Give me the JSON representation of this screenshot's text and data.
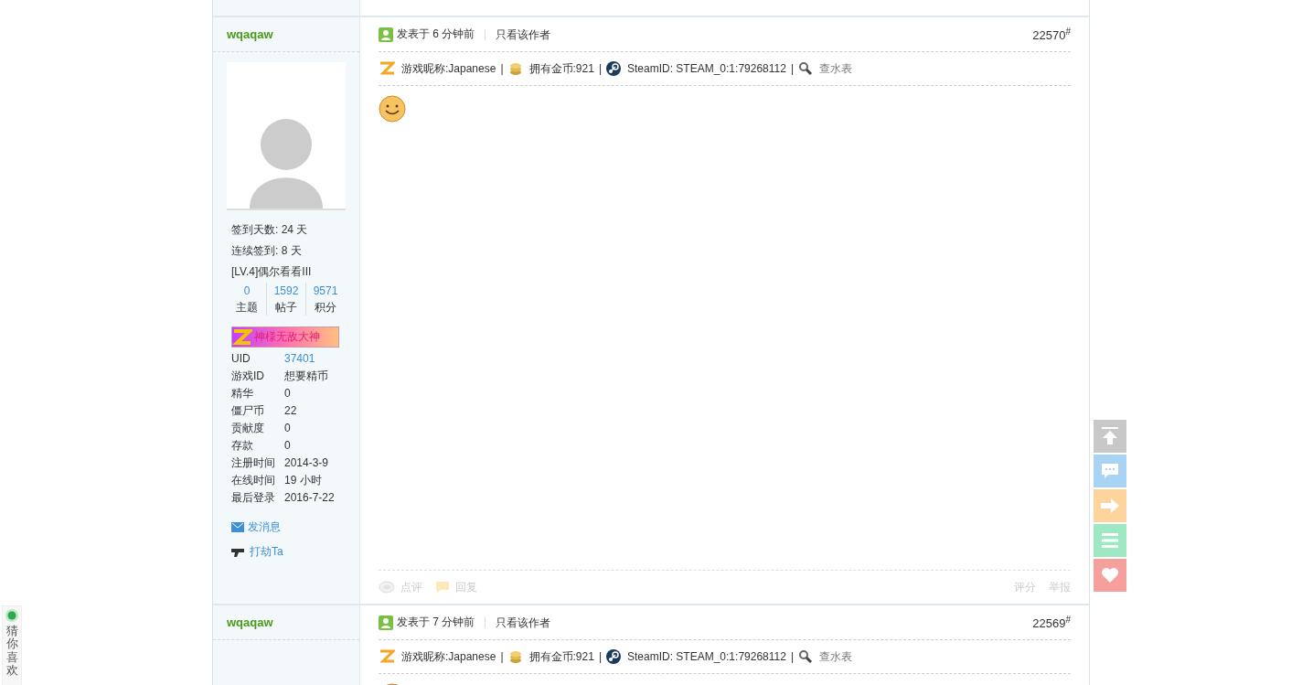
{
  "posts": [
    {
      "author": "wqaqaw",
      "posted": "发表于 6 分钟前",
      "only_author": "只看该作者",
      "floor": "22570",
      "floor_mark": "#",
      "info_separator": "|",
      "info": [
        {
          "kind": "nickname",
          "text": "游戏昵称:Japanese"
        },
        {
          "kind": "coins",
          "text": "拥有金币:921"
        },
        {
          "kind": "steam",
          "text": "SteamID: STEAM_0:1:79268112"
        },
        {
          "kind": "search",
          "text": "查水表"
        }
      ],
      "content": {
        "kind": "smiley"
      },
      "profile": {
        "lines": [
          "签到天数: 24 天",
          "连续签到: 8 天",
          "[LV.4]偶尔看看III"
        ],
        "counters": [
          {
            "value": "0",
            "label": "主题"
          },
          {
            "value": "1592",
            "label": "帖子"
          },
          {
            "value": "9571",
            "label": "积分"
          }
        ],
        "medal": "神様无敌大神",
        "fields": [
          {
            "label": "UID",
            "value": "37401",
            "link": true
          },
          {
            "label": "游戏ID",
            "value": "想要精币",
            "link": false
          },
          {
            "label": "精华",
            "value": "0",
            "link": false
          },
          {
            "label": "僵尸币",
            "value": "22",
            "link": false
          },
          {
            "label": "贡献度",
            "value": "0",
            "link": false
          },
          {
            "label": "存款",
            "value": "0",
            "link": false
          },
          {
            "label": "注册时间",
            "value": "2014-3-9",
            "link": false
          },
          {
            "label": "在线时间",
            "value": "19 小时",
            "link": false
          },
          {
            "label": "最后登录",
            "value": "2016-7-22",
            "link": false
          }
        ],
        "actions": [
          {
            "kind": "mail",
            "text": "发消息"
          },
          {
            "kind": "gun",
            "text": "打劫Ta"
          }
        ]
      },
      "footer": {
        "left_actions": [
          "点评",
          "回复"
        ],
        "right_actions": [
          "评分",
          "举报"
        ]
      }
    },
    {
      "author": "wqaqaw",
      "posted": "发表于 7 分钟前",
      "only_author": "只看该作者",
      "floor": "22569",
      "floor_mark": "#",
      "info_separator": "|",
      "info": [
        {
          "kind": "nickname",
          "text": "游戏昵称:Japanese"
        },
        {
          "kind": "coins",
          "text": "拥有金币:921"
        },
        {
          "kind": "steam",
          "text": "SteamID: STEAM_0:1:79268112"
        },
        {
          "kind": "search",
          "text": "查水表"
        }
      ],
      "content": {
        "kind": "emoji"
      }
    }
  ],
  "side_buttons": [
    {
      "kind": "top",
      "color": "#c8c8c8"
    },
    {
      "kind": "comment",
      "color": "#a9d3f5"
    },
    {
      "kind": "next",
      "color": "#fdd49b"
    },
    {
      "kind": "list",
      "color": "#9fe8c4"
    },
    {
      "kind": "heart",
      "color": "#f6a09e"
    }
  ],
  "guess_widget": {
    "label": "猜你喜欢"
  }
}
